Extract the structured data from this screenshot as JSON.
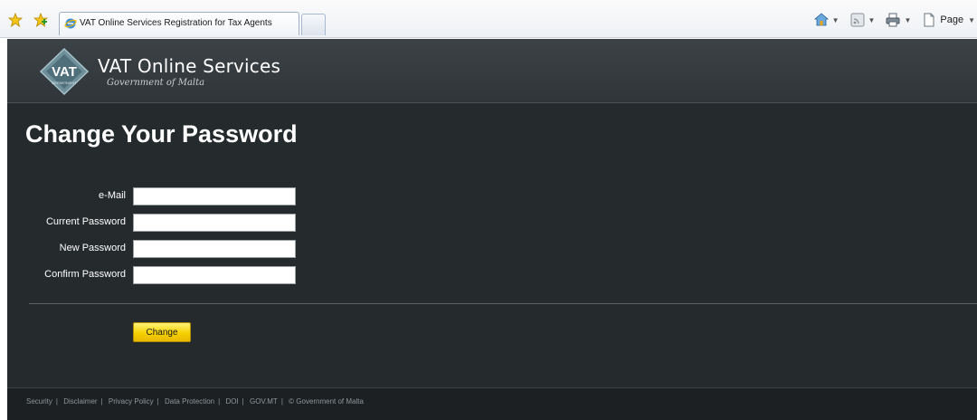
{
  "browser": {
    "tab_title": "VAT Online Services Registration for Tax Agents",
    "page_menu_label": "Page"
  },
  "header": {
    "logo_text": "VAT",
    "logo_subtext": "DEPARTMENT",
    "title": "VAT Online Services",
    "subtitle": "Government of Malta"
  },
  "main": {
    "heading": "Change Your Password",
    "fields": [
      {
        "label": "e-Mail",
        "value": ""
      },
      {
        "label": "Current Password",
        "value": ""
      },
      {
        "label": "New Password",
        "value": ""
      },
      {
        "label": "Confirm Password",
        "value": ""
      }
    ],
    "submit_label": "Change"
  },
  "footer": {
    "links": [
      "Security",
      "Disclaimer",
      "Privacy Policy",
      "Data Protection",
      "DOI",
      "GOV.MT"
    ],
    "copyright": "© Government of Malta"
  },
  "colors": {
    "page_bg": "#252a2c",
    "header_bg": "#363d40",
    "button": "#f6d100",
    "footer_bg": "#1c2022"
  },
  "icons": [
    "favorites-star-icon",
    "add-favorites-icon",
    "ie-page-icon",
    "home-icon",
    "feeds-icon",
    "print-icon",
    "page-icon"
  ]
}
